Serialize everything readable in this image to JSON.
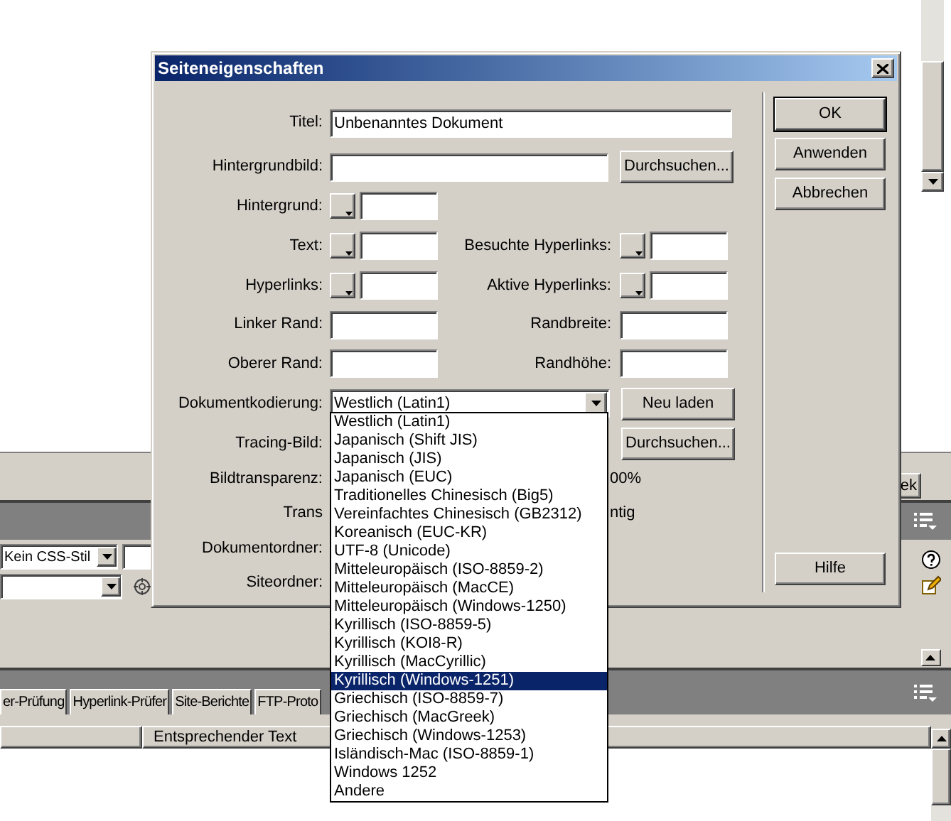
{
  "background": {
    "partial_button": "ek",
    "style_select": "Kein CSS-Stil",
    "tabs": [
      "er-Prüfung",
      "Hyperlink-Prüfer",
      "Site-Berichte",
      "FTP-Proto"
    ],
    "column_header": "Entsprechender Text"
  },
  "dialog": {
    "title": "Seiteneigenschaften",
    "rows": [
      {
        "left": {
          "label": "Titel:",
          "kind": "wide",
          "value": "Unbenanntes Dokument"
        }
      },
      {
        "left": {
          "label": "Hintergrundbild:",
          "kind": "path"
        },
        "button": "Durchsuchen..."
      },
      {
        "left": {
          "label": "Hintergrund:",
          "kind": "color"
        }
      },
      {
        "left": {
          "label": "Text:",
          "kind": "color"
        },
        "right": {
          "label": "Besuchte Hyperlinks:",
          "kind": "color"
        }
      },
      {
        "left": {
          "label": "Hyperlinks:",
          "kind": "color"
        },
        "right": {
          "label": "Aktive Hyperlinks:",
          "kind": "color"
        }
      },
      {
        "left": {
          "label": "Linker Rand:",
          "kind": "short"
        },
        "right": {
          "label": "Randbreite:",
          "kind": "short"
        }
      },
      {
        "left": {
          "label": "Oberer Rand:",
          "kind": "short"
        },
        "right": {
          "label": "Randhöhe:",
          "kind": "short"
        }
      },
      {
        "left": {
          "label": "Dokumentkodierung:",
          "kind": "select",
          "value": "Westlich (Latin1)"
        },
        "button": "Neu laden"
      },
      {
        "left": {
          "label": "Tracing-Bild:",
          "kind": "hidden"
        },
        "button": "Durchsuchen..."
      },
      {
        "left": {
          "label": "Bildtransparenz:",
          "kind": "hidden"
        },
        "tail": "00%"
      },
      {
        "left": {
          "label": "Trans",
          "kind": "hidden"
        },
        "tail": "ntig"
      },
      {
        "left": {
          "label": "Dokumentordner:",
          "kind": "hidden"
        }
      },
      {
        "left": {
          "label": "Siteordner:",
          "kind": "hidden"
        }
      }
    ],
    "buttons": [
      {
        "label": "OK",
        "default": true
      },
      {
        "label": "Anwenden",
        "default": false
      },
      {
        "label": "Abbrechen",
        "default": false
      }
    ],
    "help_button": "Hilfe",
    "encoding_list": [
      {
        "label": "Westlich (Latin1)",
        "selected": false
      },
      {
        "label": "Japanisch (Shift JIS)",
        "selected": false
      },
      {
        "label": "Japanisch (JIS)",
        "selected": false
      },
      {
        "label": "Japanisch (EUC)",
        "selected": false
      },
      {
        "label": "Traditionelles Chinesisch (Big5)",
        "selected": false
      },
      {
        "label": "Vereinfachtes Chinesisch (GB2312)",
        "selected": false
      },
      {
        "label": "Koreanisch (EUC-KR)",
        "selected": false
      },
      {
        "label": "UTF-8 (Unicode)",
        "selected": false
      },
      {
        "label": "Mitteleuropäisch (ISO-8859-2)",
        "selected": false
      },
      {
        "label": "Mitteleuropäisch (MacCE)",
        "selected": false
      },
      {
        "label": "Mitteleuropäisch (Windows-1250)",
        "selected": false
      },
      {
        "label": "Kyrillisch (ISO-8859-5)",
        "selected": false
      },
      {
        "label": "Kyrillisch (KOI8-R)",
        "selected": false
      },
      {
        "label": "Kyrillisch (MacCyrillic)",
        "selected": false
      },
      {
        "label": "Kyrillisch (Windows-1251)",
        "selected": true
      },
      {
        "label": "Griechisch (ISO-8859-7)",
        "selected": false
      },
      {
        "label": "Griechisch (MacGreek)",
        "selected": false
      },
      {
        "label": "Griechisch (Windows-1253)",
        "selected": false
      },
      {
        "label": "Isländisch-Mac (ISO-8859-1)",
        "selected": false
      },
      {
        "label": "Windows 1252",
        "selected": false
      },
      {
        "label": "Andere",
        "selected": false
      }
    ]
  }
}
